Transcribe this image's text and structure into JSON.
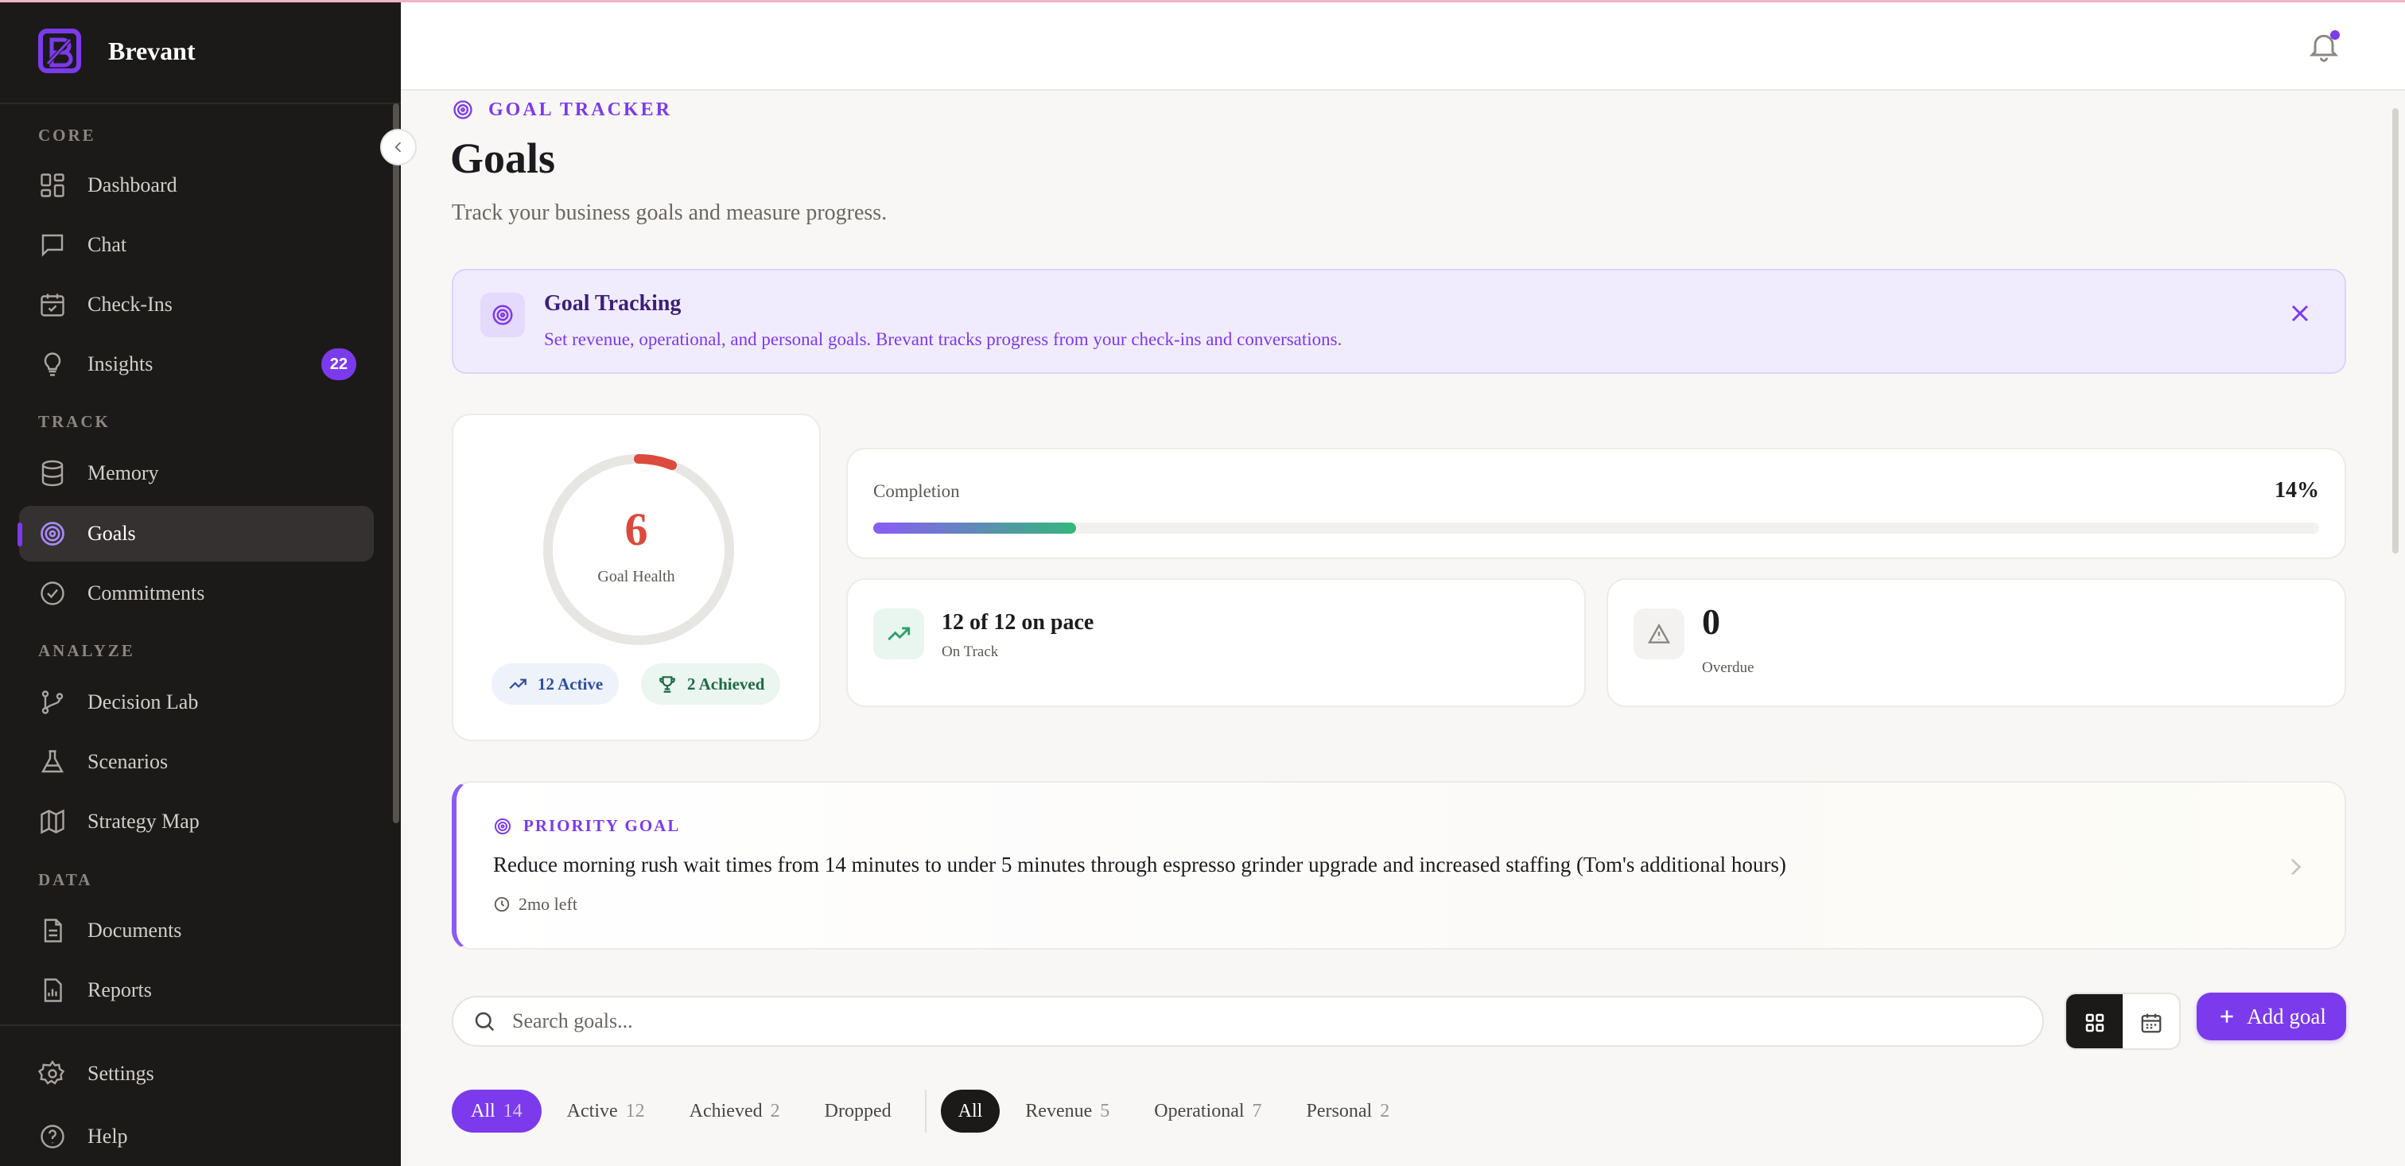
{
  "brand": {
    "name": "Brevant"
  },
  "sidebar": {
    "sections": [
      "CORE",
      "TRACK",
      "ANALYZE",
      "DATA"
    ],
    "items": [
      {
        "label": "Dashboard",
        "icon": "grid-icon"
      },
      {
        "label": "Chat",
        "icon": "message-icon"
      },
      {
        "label": "Check-Ins",
        "icon": "calendar-check-icon"
      },
      {
        "label": "Insights",
        "icon": "lightbulb-icon",
        "badge": "22"
      },
      {
        "label": "Memory",
        "icon": "database-icon"
      },
      {
        "label": "Goals",
        "icon": "target-icon",
        "active": true
      },
      {
        "label": "Commitments",
        "icon": "check-circle-icon"
      },
      {
        "label": "Decision Lab",
        "icon": "branch-icon"
      },
      {
        "label": "Scenarios",
        "icon": "flask-icon"
      },
      {
        "label": "Strategy Map",
        "icon": "map-icon"
      },
      {
        "label": "Documents",
        "icon": "document-icon"
      },
      {
        "label": "Reports",
        "icon": "report-icon"
      },
      {
        "label": "Settings",
        "icon": "gear-icon"
      },
      {
        "label": "Help",
        "icon": "help-icon"
      }
    ]
  },
  "header": {
    "eyebrow": "GOAL TRACKER",
    "title": "Goals",
    "subtitle": "Track your business goals and measure progress."
  },
  "banner": {
    "title": "Goal Tracking",
    "text": "Set revenue, operational, and personal goals. Brevant tracks progress from your check-ins and conversations."
  },
  "health": {
    "value": "6",
    "label": "Goal Health",
    "ring_fraction": 0.06,
    "ring_color": "#dc4a3d",
    "active": "12 Active",
    "achieved": "2 Achieved"
  },
  "completion": {
    "label": "Completion",
    "value": "14%",
    "fraction": 0.14
  },
  "pace": {
    "value": "12 of 12 on pace",
    "label": "On Track"
  },
  "overdue": {
    "value": "0",
    "label": "Overdue"
  },
  "priority": {
    "eyebrow": "PRIORITY GOAL",
    "title": "Reduce morning rush wait times from 14 minutes to under 5 minutes through espresso grinder upgrade and increased staffing (Tom's additional hours)",
    "time_left": "2mo left"
  },
  "search": {
    "placeholder": "Search goals...",
    "value": ""
  },
  "actions": {
    "add_goal": "Add goal"
  },
  "status_filters": [
    {
      "label": "All",
      "count": "14",
      "selected": true
    },
    {
      "label": "Active",
      "count": "12"
    },
    {
      "label": "Achieved",
      "count": "2"
    },
    {
      "label": "Dropped",
      "count": ""
    }
  ],
  "type_filters": [
    {
      "label": "All",
      "count": "",
      "selected": true
    },
    {
      "label": "Revenue",
      "count": "5"
    },
    {
      "label": "Operational",
      "count": "7"
    },
    {
      "label": "Personal",
      "count": "2"
    }
  ],
  "colors": {
    "accent": "#7c3aed",
    "sidebar_bg": "#1c1a19",
    "health": "#dc4a3d",
    "success": "#34b77a"
  }
}
